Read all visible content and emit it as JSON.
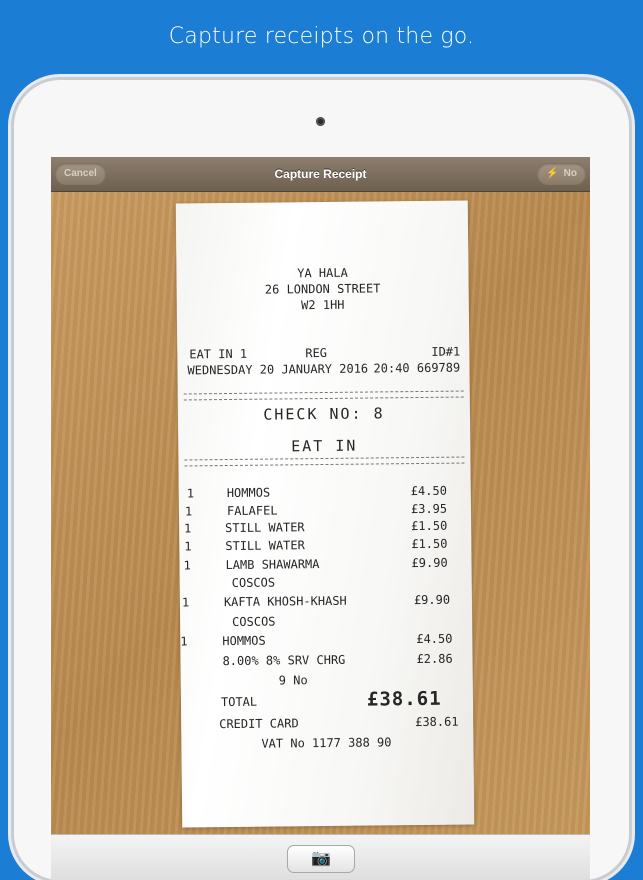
{
  "headline": "Capture receipts on the go.",
  "navbar": {
    "title": "Capture Receipt",
    "cancel_label": "Cancel",
    "flash_label": "No",
    "flash_icon": "flash-bolt"
  },
  "receipt": {
    "store_name": "YA HALA",
    "address_1": "26 LONDON STREET",
    "address_2": "W2 1HH",
    "eat_in": "EAT IN 1",
    "reg": "REG",
    "id": "ID#1",
    "date": "WEDNESDAY 20 JANUARY 2016",
    "time_code": "20:40 669789",
    "check_no": "CHECK NO: 8",
    "eat_in_heading": "EAT IN",
    "items": [
      {
        "qty": "1",
        "name": "HOMMOS",
        "price": "£4.50"
      },
      {
        "qty": "1",
        "name": "FALAFEL",
        "price": "£3.95"
      },
      {
        "qty": "1",
        "name": "STILL WATER",
        "price": "£1.50"
      },
      {
        "qty": "1",
        "name": "STILL WATER",
        "price": "£1.50"
      },
      {
        "qty": "1",
        "name": "LAMB SHAWARMA",
        "price": "£9.90"
      },
      {
        "qty": "",
        "name": "COSCOS",
        "price": ""
      },
      {
        "qty": "1",
        "name": "KAFTA KHOSH-KHASH",
        "price": "£9.90"
      },
      {
        "qty": "",
        "name": "COSCOS",
        "price": ""
      },
      {
        "qty": "1",
        "name": "HOMMOS",
        "price": "£4.50"
      },
      {
        "qty": "",
        "name": "8.00% 8% SRV CHRG",
        "price": "£2.86"
      }
    ],
    "items_count": "9 No",
    "total_label": "TOTAL",
    "total_amount": "£38.61",
    "payment_label": "CREDIT CARD",
    "payment_amount": "£38.61",
    "vat": "VAT No 1177 388 90"
  },
  "toolbar": {
    "capture_icon": "camera"
  }
}
